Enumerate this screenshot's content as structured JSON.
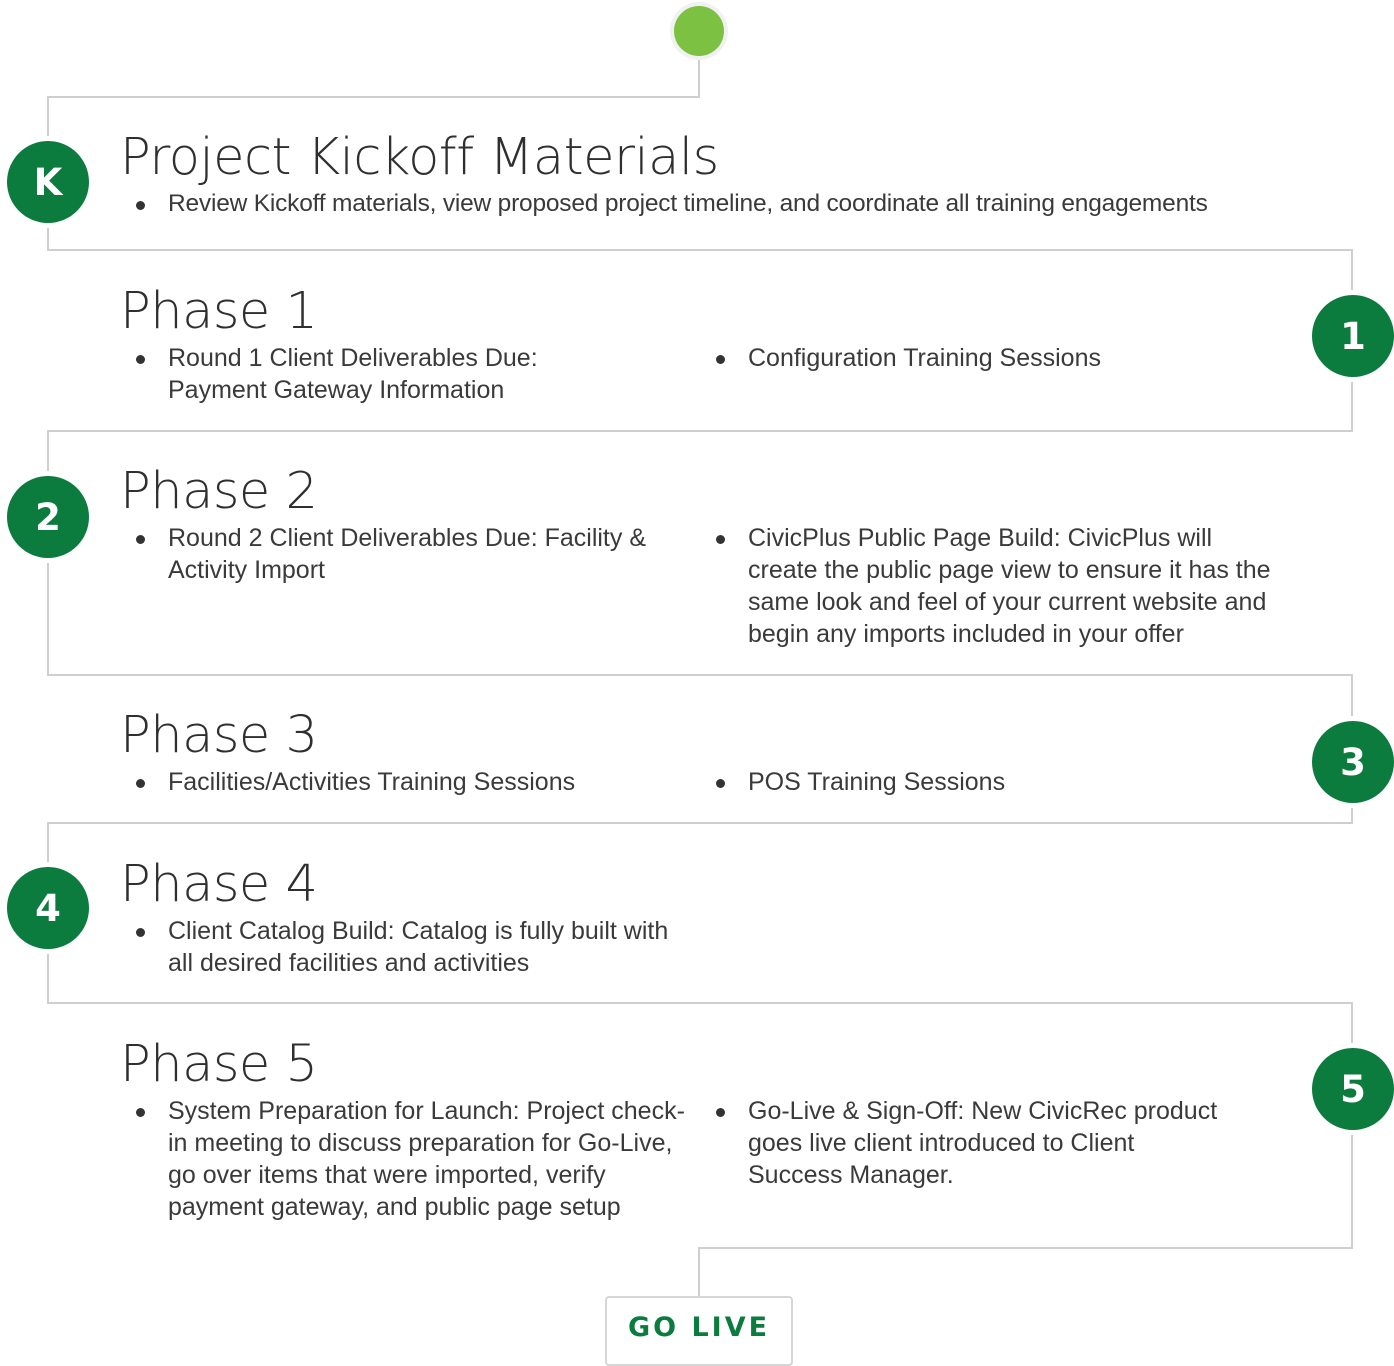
{
  "colors": {
    "badge_green": "#0b7b3e",
    "start_dot": "#7cc142",
    "line_gray": "#cfcfcf",
    "text": "#2f2f2f"
  },
  "kickoff": {
    "badge": "K",
    "title": "Project Kickoff Materials",
    "bullets": [
      "Review Kickoff materials, view proposed project timeline, and coordinate all training engagements"
    ]
  },
  "phases": [
    {
      "badge": "1",
      "title": "Phase 1",
      "left": [
        "Round 1 Client Deliverables Due: Payment Gateway Information"
      ],
      "right": [
        "Configuration Training Sessions"
      ]
    },
    {
      "badge": "2",
      "title": "Phase 2",
      "left": [
        "Round 2 Client Deliverables Due: Facility & Activity Import"
      ],
      "right": [
        "CivicPlus Public Page Build: CivicPlus will create the public page view to ensure it has the same look and feel of your current website and begin any imports included in your offer"
      ]
    },
    {
      "badge": "3",
      "title": "Phase 3",
      "left": [
        "Facilities/Activities Training Sessions"
      ],
      "right": [
        "POS Training Sessions"
      ]
    },
    {
      "badge": "4",
      "title": "Phase 4",
      "left": [
        "Client Catalog Build: Catalog is fully built with all desired facilities and activities"
      ],
      "right": []
    },
    {
      "badge": "5",
      "title": "Phase 5",
      "left": [
        "System Preparation for Launch: Project check-in meeting to discuss preparation for Go-Live, go over items that were imported, verify payment gateway, and public page setup"
      ],
      "right": [
        "Go-Live & Sign-Off: New CivicRec product goes live client introduced to Client Success Manager."
      ]
    }
  ],
  "go_live": {
    "label": "GO LIVE"
  }
}
